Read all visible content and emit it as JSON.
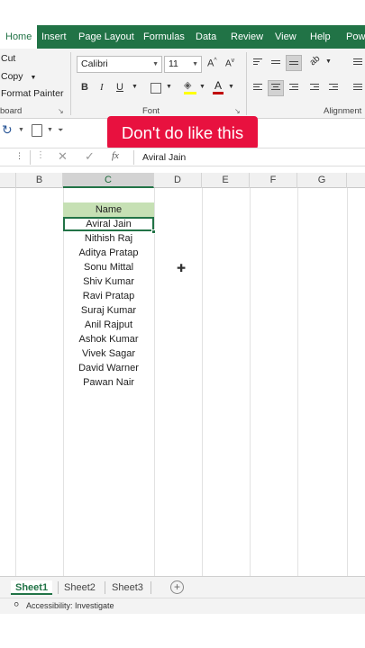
{
  "ribbon_tabs": [
    "Home",
    "Insert",
    "Page Layout",
    "Formulas",
    "Data",
    "Review",
    "View",
    "Help",
    "Powe"
  ],
  "clipboard": {
    "cut": "Cut",
    "copy": "Copy",
    "format_painter": "Format Painter",
    "group_label": "board"
  },
  "font": {
    "family": "Calibri",
    "size": "11",
    "group_label": "Font",
    "bold": "B",
    "italic": "I",
    "underline": "U",
    "font_color_letter": "A"
  },
  "alignment": {
    "group_label": "Alignment"
  },
  "banner": {
    "text": "Don't do like this"
  },
  "formula_bar": {
    "fx": "fx",
    "value": "Aviral Jain"
  },
  "columns": [
    "B",
    "C",
    "D",
    "E",
    "F",
    "G"
  ],
  "table": {
    "header": "Name",
    "rows": [
      "Aviral Jain",
      "Nithish Raj",
      "Aditya Pratap",
      "Sonu Mittal",
      "Shiv Kumar",
      "Ravi Pratap",
      "Suraj Kumar",
      "Anil Rajput",
      "Ashok Kumar",
      "Vivek Sagar",
      "David Warner",
      "Pawan Nair"
    ]
  },
  "sheets": [
    "Sheet1",
    "Sheet2",
    "Sheet3"
  ],
  "status": {
    "accessibility": "Accessibility: Investigate"
  },
  "colors": {
    "accent": "#217346",
    "banner": "#e8113f",
    "header_fill": "#c6e0b4",
    "font_color": "#c00000",
    "fill_color": "#ffff00"
  }
}
